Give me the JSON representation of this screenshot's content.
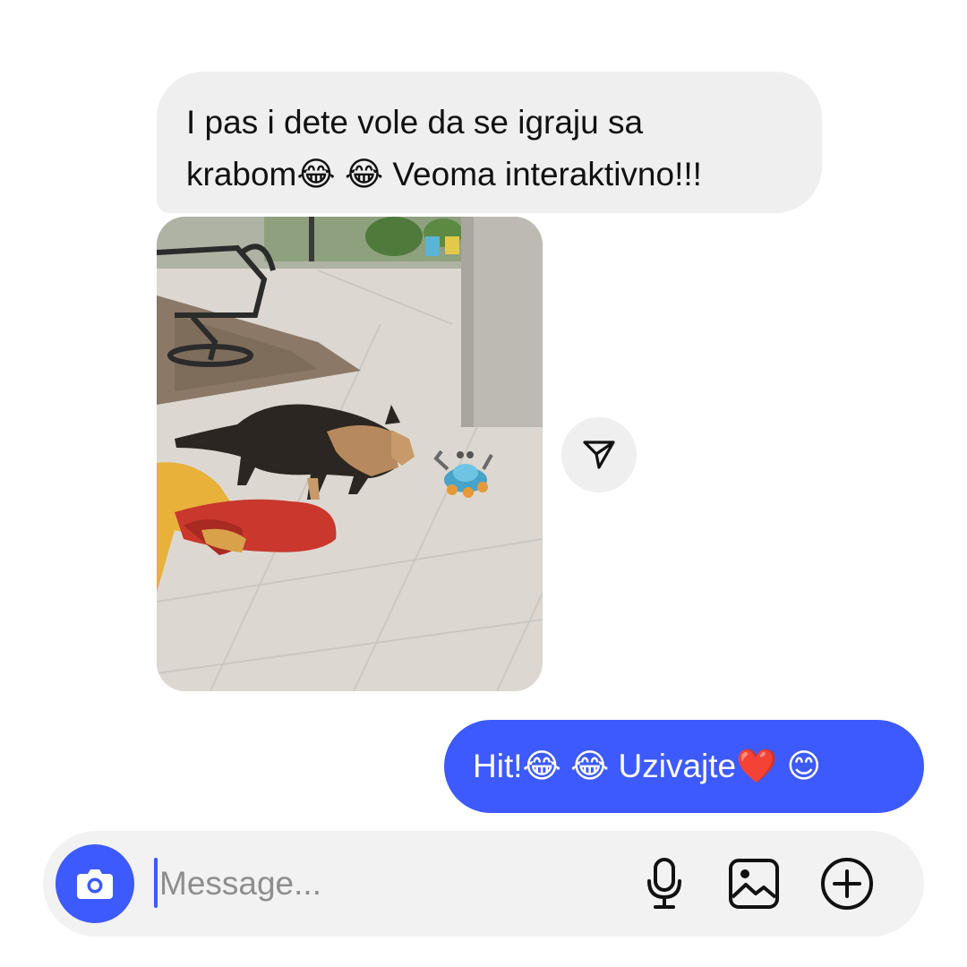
{
  "messages": {
    "incoming_text": "I pas i dete vole da se igraju sa\nkrabom😂 😂  Veoma interaktivno!!!",
    "outgoing_text": "Hit!😂 😂 Uzivajte❤️ 😊"
  },
  "media": {
    "icon": "share-icon"
  },
  "composer": {
    "placeholder": "Message...",
    "camera_icon": "camera-icon",
    "mic_icon": "microphone-icon",
    "gallery_icon": "image-icon",
    "plus_icon": "plus-circle-icon"
  },
  "colors": {
    "accent": "#3d5afe",
    "incoming_bubble": "#efefef",
    "composer_bg": "#f2f2f2"
  }
}
